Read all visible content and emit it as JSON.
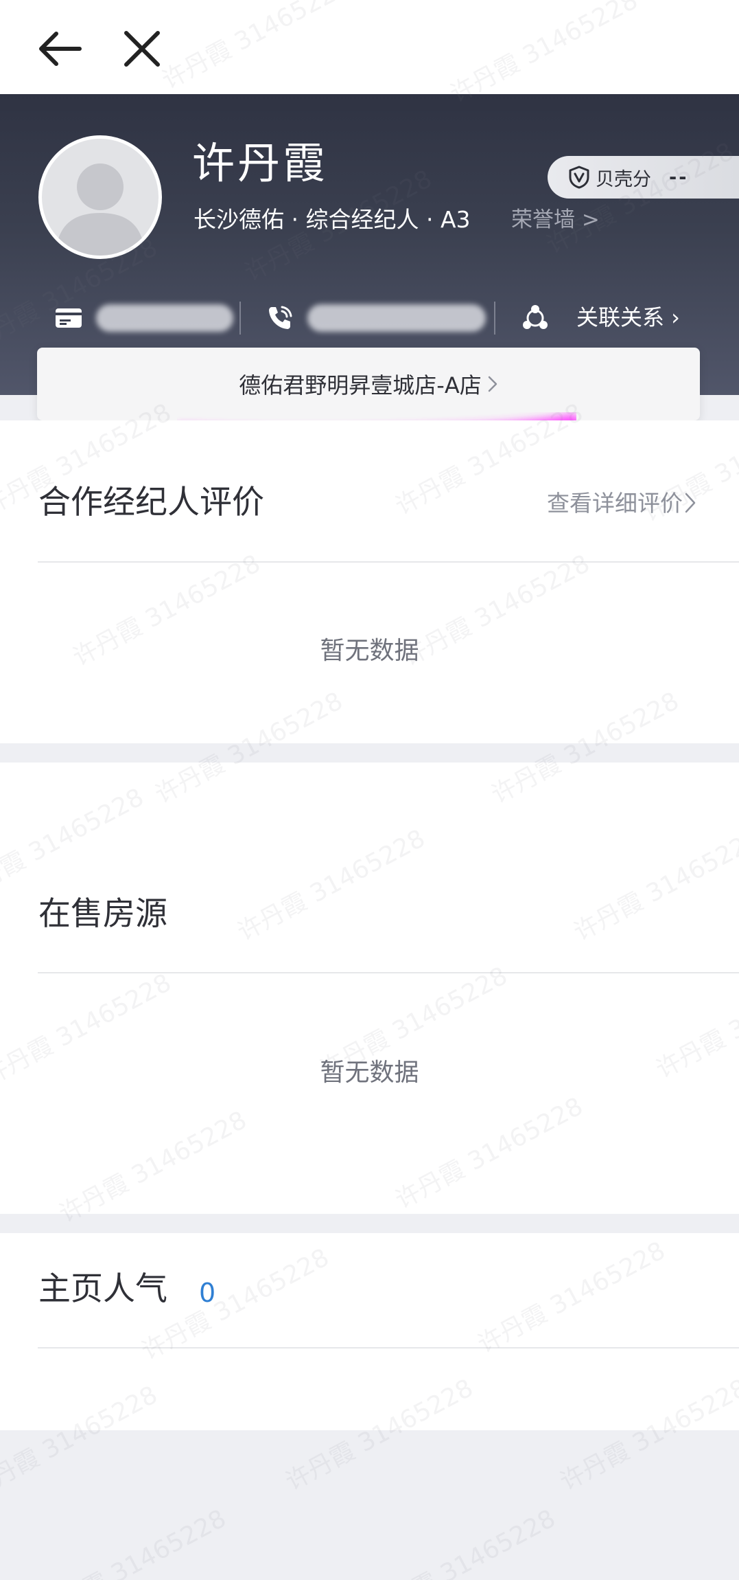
{
  "profile": {
    "name": "许丹霞",
    "subtitle": "长沙德佑 · 综合经纪人 · A3",
    "honor_link": "荣誉墙 >",
    "score_label": "贝壳分",
    "score_value": "--",
    "relation_link": "关联关系 ›",
    "store_name": "德佑君野明昇壹城店-A店"
  },
  "reviews": {
    "title": "合作经纪人评价",
    "detail_link": "查看详细评价",
    "empty": "暂无数据"
  },
  "listings": {
    "title": "在售房源",
    "empty": "暂无数据"
  },
  "popularity": {
    "title": "主页人气",
    "count": "0",
    "count_color": "#2f7fd3"
  },
  "watermark": {
    "text": "许丹霞 31465228"
  },
  "icons": {
    "back": "arrow-left-icon",
    "close": "close-icon",
    "shield": "shield-v-icon",
    "id_card": "id-card-icon",
    "phone": "phone-icon",
    "relation": "relation-network-icon",
    "chevron": "chevron-right-icon"
  },
  "colors": {
    "header_bg": "#3a3e4d",
    "highlight": "#ff30ff"
  }
}
